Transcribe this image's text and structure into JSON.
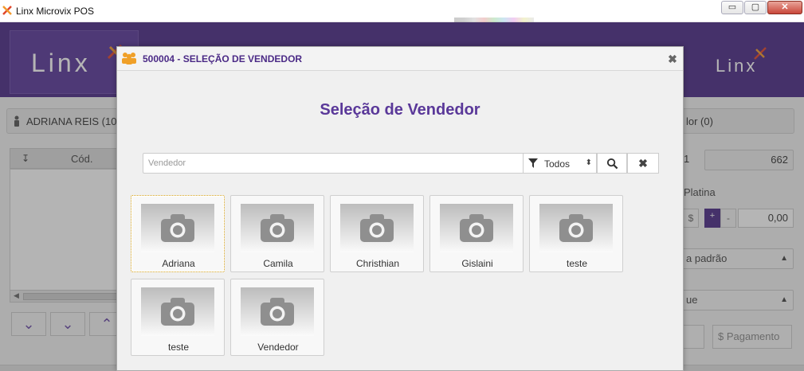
{
  "window": {
    "title": "Linx Microvix POS",
    "min_label": "▭",
    "max_label": "▢",
    "close_label": "✕"
  },
  "header": {
    "logo_text": "Linx",
    "logo_right_text": "Linx"
  },
  "background": {
    "seller_label": "ADRIANA REIS (10",
    "grid_col_arrow": "↧",
    "grid_col_cod": "Cód.",
    "right_seller_label": "lor (0)",
    "qty": "1",
    "qty_input": "662",
    "platina_label": "Platina",
    "dollar": "$",
    "plus": "+",
    "minus": "-",
    "value": "0,00",
    "select1": "a padrão",
    "select2": "ue",
    "pay_label": "$ Pagamento",
    "nav_down_all": "⌄",
    "nav_down": "⌄",
    "nav_up": "⌃"
  },
  "modal": {
    "title": "500004 - SELEÇÃO DE VENDEDOR",
    "close": "✖",
    "heading": "Seleção de Vendedor",
    "search_placeholder": "Vendedor",
    "filter_label": "Todos",
    "clear_label": "✖",
    "sellers": [
      {
        "name": "Adriana",
        "selected": true
      },
      {
        "name": "Camila"
      },
      {
        "name": "Christhian"
      },
      {
        "name": "Gislaini"
      },
      {
        "name": "teste"
      },
      {
        "name": "teste"
      },
      {
        "name": "Vendedor"
      }
    ]
  },
  "colors": {
    "brand_purple": "#4b2a86",
    "accent_orange": "#f08a2a",
    "heading_purple": "#5a3899"
  }
}
